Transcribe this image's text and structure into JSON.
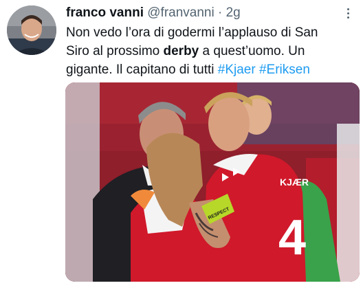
{
  "tweet": {
    "author_name": "franco vanni",
    "author_handle": "@franvanni",
    "separator": "·",
    "time": "2g",
    "line1": "Non vedo l’ora di godermi l’applauso di San",
    "line2_pre": "Siro al prossimo ",
    "line2_bold": "derby",
    "line2_post": " a quest’uomo. Un",
    "line3_pre": "gigante. Il capitano di tutti ",
    "hashtag1": "#Kjaer",
    "hashtag2": "#Eriksen",
    "more_icon": "more-vertical-icon"
  },
  "photo": {
    "jersey_name": "KJÆR",
    "jersey_number": "4",
    "armband_text": "RESPECT",
    "colors": {
      "jersey_red": "#d0192b",
      "stadium_red": "#8e1f2b",
      "armband": "#b7d829",
      "keeper_green": "#3aa24a"
    }
  }
}
